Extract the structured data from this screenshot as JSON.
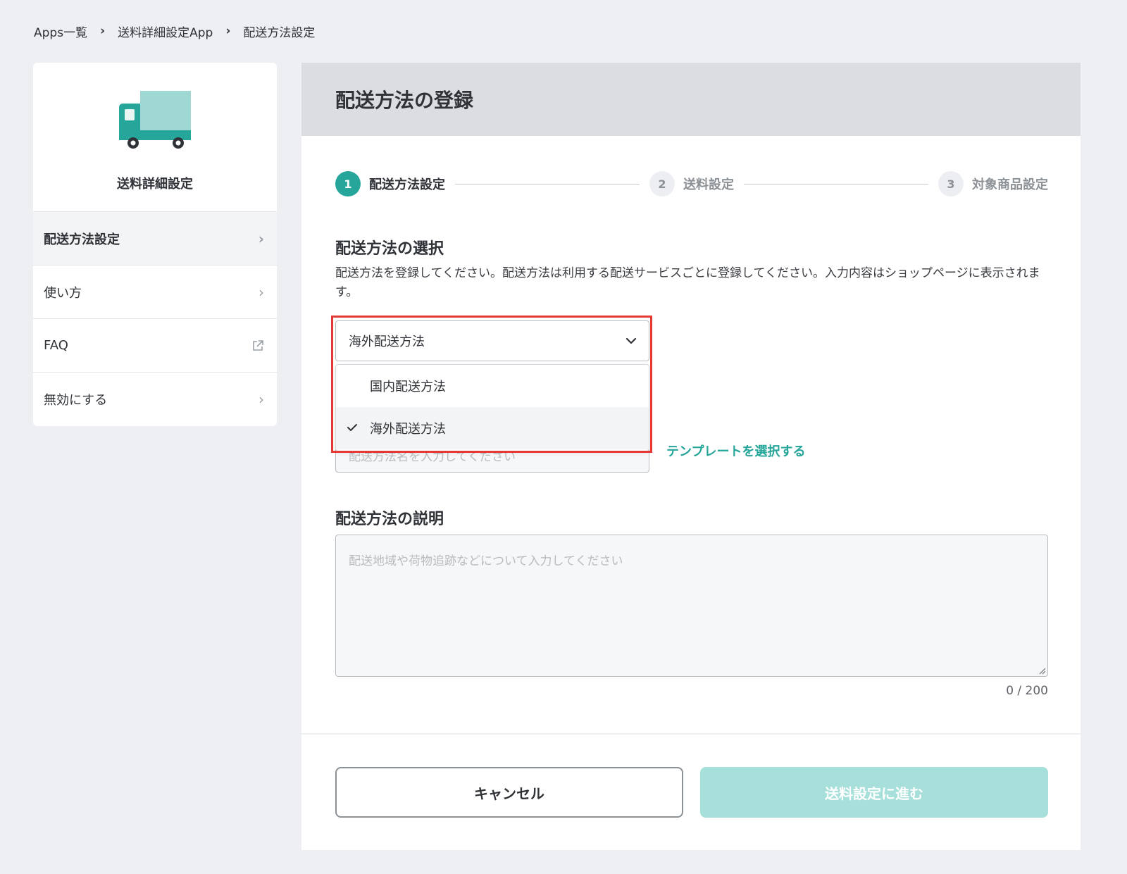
{
  "breadcrumb": [
    "Apps一覧",
    "送料詳細設定App",
    "配送方法設定"
  ],
  "sidebar": {
    "app_name": "送料詳細設定",
    "items": [
      {
        "label": "配送方法設定",
        "icon": "chevron-right-icon"
      },
      {
        "label": "使い方",
        "icon": "chevron-right-icon"
      },
      {
        "label": "FAQ",
        "icon": "external-link-icon"
      },
      {
        "label": "無効にする",
        "icon": "chevron-right-icon"
      }
    ]
  },
  "panel": {
    "title": "配送方法の登録",
    "steps": [
      {
        "num": "1",
        "label": "配送方法設定",
        "state": "active"
      },
      {
        "num": "2",
        "label": "送料設定",
        "state": "inactive"
      },
      {
        "num": "3",
        "label": "対象商品設定",
        "state": "inactive"
      }
    ],
    "section1": {
      "title": "配送方法の選択",
      "description": "配送方法を登録してください。配送方法は利用する配送サービスごとに登録してください。入力内容はショップページに表示されます。"
    },
    "select": {
      "value": "海外配送方法",
      "options": [
        {
          "label": "国内配送方法",
          "selected": false
        },
        {
          "label": "海外配送方法",
          "selected": true
        }
      ]
    },
    "name_input": {
      "placeholder": "配送方法名を入力してください"
    },
    "template_link": "テンプレートを選択する",
    "section2": {
      "title": "配送方法の説明",
      "placeholder": "配送地域や荷物追跡などについて入力してください",
      "counter": "0 / 200"
    },
    "buttons": {
      "cancel": "キャンセル",
      "next": "送料設定に進む"
    }
  },
  "colors": {
    "accent": "#26a69a",
    "disabled_accent": "#a7dfda",
    "highlight": "#e53935"
  }
}
